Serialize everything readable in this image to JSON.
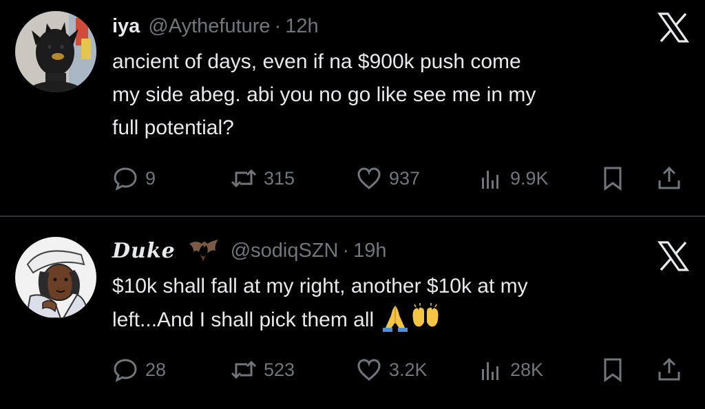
{
  "tweets": [
    {
      "display_name": "iya",
      "handle": "@Aythefuture",
      "separator": "·",
      "time": "12h",
      "text_lines": [
        "ancient of days, even if na $900k push come",
        "my side abeg. abi you no go like see me in my",
        "full potential?"
      ],
      "stats": {
        "replies": "9",
        "reposts": "315",
        "likes": "937",
        "views": "9.9K"
      },
      "icons": {
        "platform": "x-logo-icon",
        "reply": "speech-bubble-icon",
        "repost": "repost-arrows-icon",
        "like": "heart-icon",
        "views": "bar-chart-icon",
        "bookmark": "bookmark-icon",
        "share": "share-upload-icon"
      }
    },
    {
      "display_name": "Duke",
      "name_emoji": "bat-emoji",
      "handle": "@sodiqSZN",
      "separator": "·",
      "time": "19h",
      "text_lines": [
        "$10k shall fall at my right, another $10k at my",
        "left...And I shall pick them all"
      ],
      "trailing_emojis": [
        "folded-hands-emoji",
        "raised-hands-emoji"
      ],
      "stats": {
        "replies": "28",
        "reposts": "523",
        "likes": "3.2K",
        "views": "28K"
      },
      "icons": {
        "platform": "x-logo-icon",
        "reply": "speech-bubble-icon",
        "repost": "repost-arrows-icon",
        "like": "heart-icon",
        "views": "bar-chart-icon",
        "bookmark": "bookmark-icon",
        "share": "share-upload-icon"
      }
    }
  ],
  "colors": {
    "background": "#000000",
    "primary_text": "#e7e9ea",
    "secondary_text": "#71767b",
    "divider": "#2f3336"
  }
}
